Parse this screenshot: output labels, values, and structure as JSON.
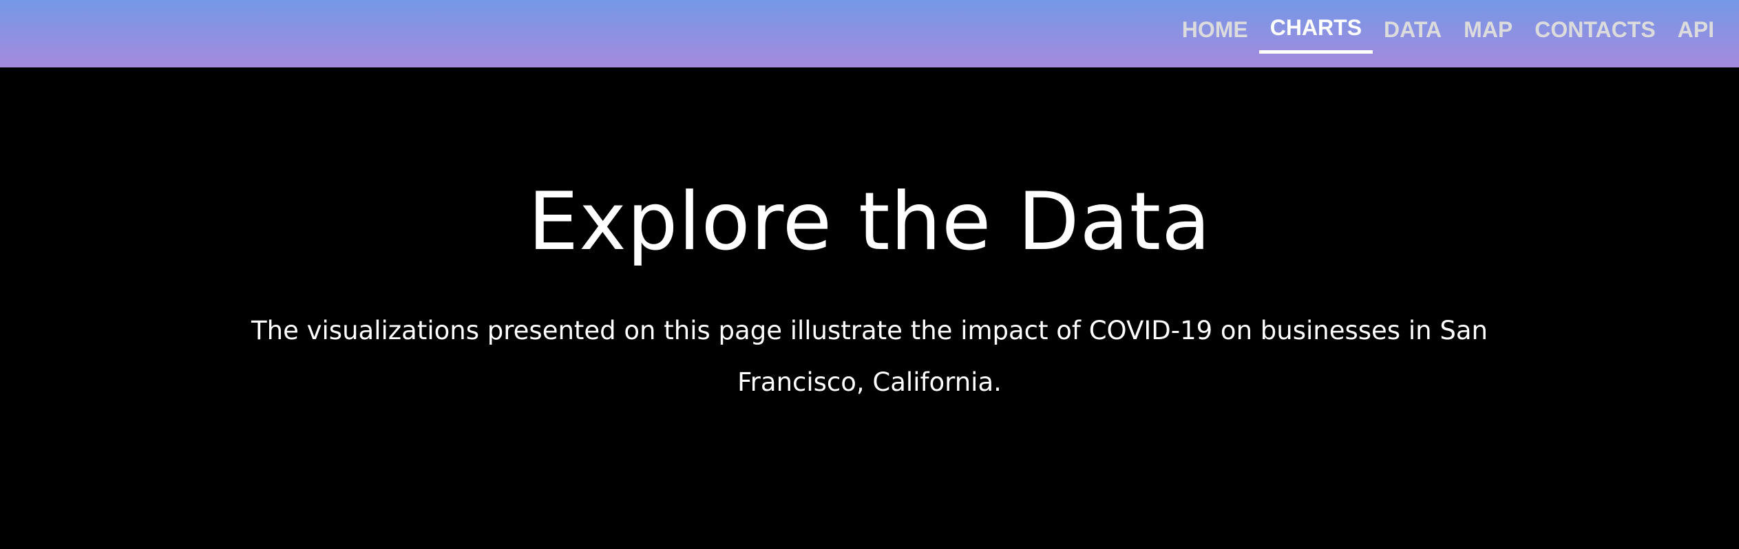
{
  "nav": {
    "items": [
      {
        "label": "HOME",
        "active": false
      },
      {
        "label": "CHARTS",
        "active": true
      },
      {
        "label": "DATA",
        "active": false
      },
      {
        "label": "MAP",
        "active": false
      },
      {
        "label": "CONTACTS",
        "active": false
      },
      {
        "label": "API",
        "active": false
      }
    ]
  },
  "hero": {
    "title": "Explore the Data",
    "description": "The visualizations presented on this page illustrate the impact of COVID-19 on businesses in San Francisco, California."
  },
  "colors": {
    "nav_gradient_top": "#7598e6",
    "nav_gradient_bottom": "#a58ade",
    "background": "#000000",
    "text": "#ffffff",
    "nav_text_inactive": "#dcdcdc"
  }
}
